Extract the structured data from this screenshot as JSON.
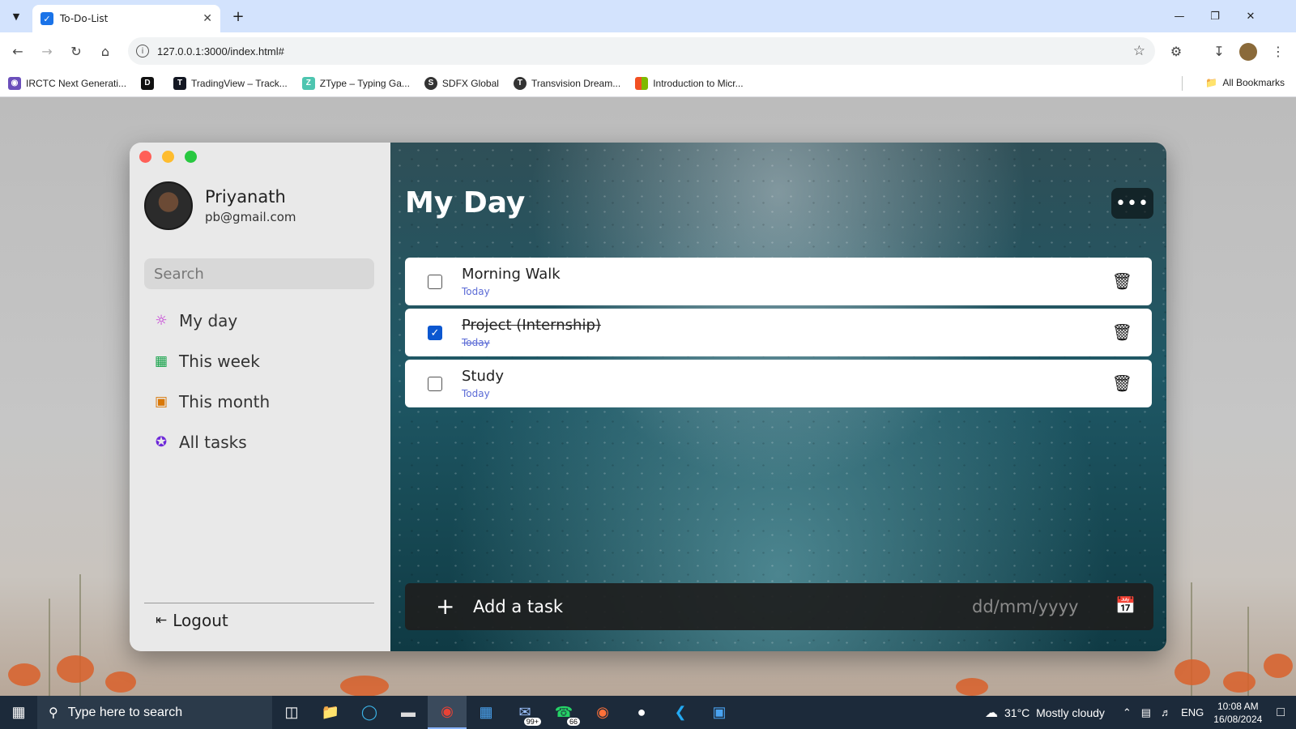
{
  "browser": {
    "tab_title": "To-Do-List",
    "url": "127.0.0.1:3000/index.html#",
    "bookmarks": [
      {
        "label": "IRCTC Next Generati...",
        "icon": "irctc-icon",
        "color": "#6b4fbb"
      },
      {
        "label": "",
        "icon": "d-icon",
        "color": "#111111"
      },
      {
        "label": "TradingView – Track...",
        "icon": "tradingview-icon",
        "color": "#131722"
      },
      {
        "label": "ZType – Typing Ga...",
        "icon": "ztype-icon",
        "color": "#4ec5b0"
      },
      {
        "label": "SDFX Global",
        "icon": "sdfx-icon",
        "color": "#333333"
      },
      {
        "label": "Transvision Dream...",
        "icon": "transvision-icon",
        "color": "#333333"
      },
      {
        "label": "Introduction to Micr...",
        "icon": "microsoft-icon",
        "color": "#f25022"
      }
    ],
    "all_bookmarks": "All Bookmarks"
  },
  "sidebar": {
    "user_name": "Priyanath",
    "user_email": "pb@gmail.com",
    "search_placeholder": "Search",
    "nav": [
      {
        "label": "My day",
        "icon": "sun-icon",
        "icon_color": "#c026d3"
      },
      {
        "label": "This week",
        "icon": "grid-icon",
        "icon_color": "#16a34a"
      },
      {
        "label": "This month",
        "icon": "calendar-icon",
        "icon_color": "#d97706"
      },
      {
        "label": "All tasks",
        "icon": "star-icon",
        "icon_color": "#6d28d9"
      }
    ],
    "logout_label": "Logout"
  },
  "main": {
    "title": "My Day",
    "tasks": [
      {
        "name": "Morning Walk",
        "date": "Today",
        "completed": false
      },
      {
        "name": "Project (Internship)",
        "date": "Today",
        "completed": true
      },
      {
        "name": "Study",
        "date": "Today",
        "completed": false
      }
    ],
    "add_task_placeholder": "Add a task",
    "date_placeholder": "dd/mm/yyyy"
  },
  "taskbar": {
    "search_placeholder": "Type here to search",
    "weather_temp": "31°C",
    "weather_desc": "Mostly cloudy",
    "language": "ENG",
    "time": "10:08 AM",
    "date": "16/08/2024",
    "badge_mail": "99+",
    "badge_whatsapp": "66"
  },
  "colors": {
    "checkbox_checked": "#0b57d0",
    "date_text": "#5b6bd6"
  }
}
